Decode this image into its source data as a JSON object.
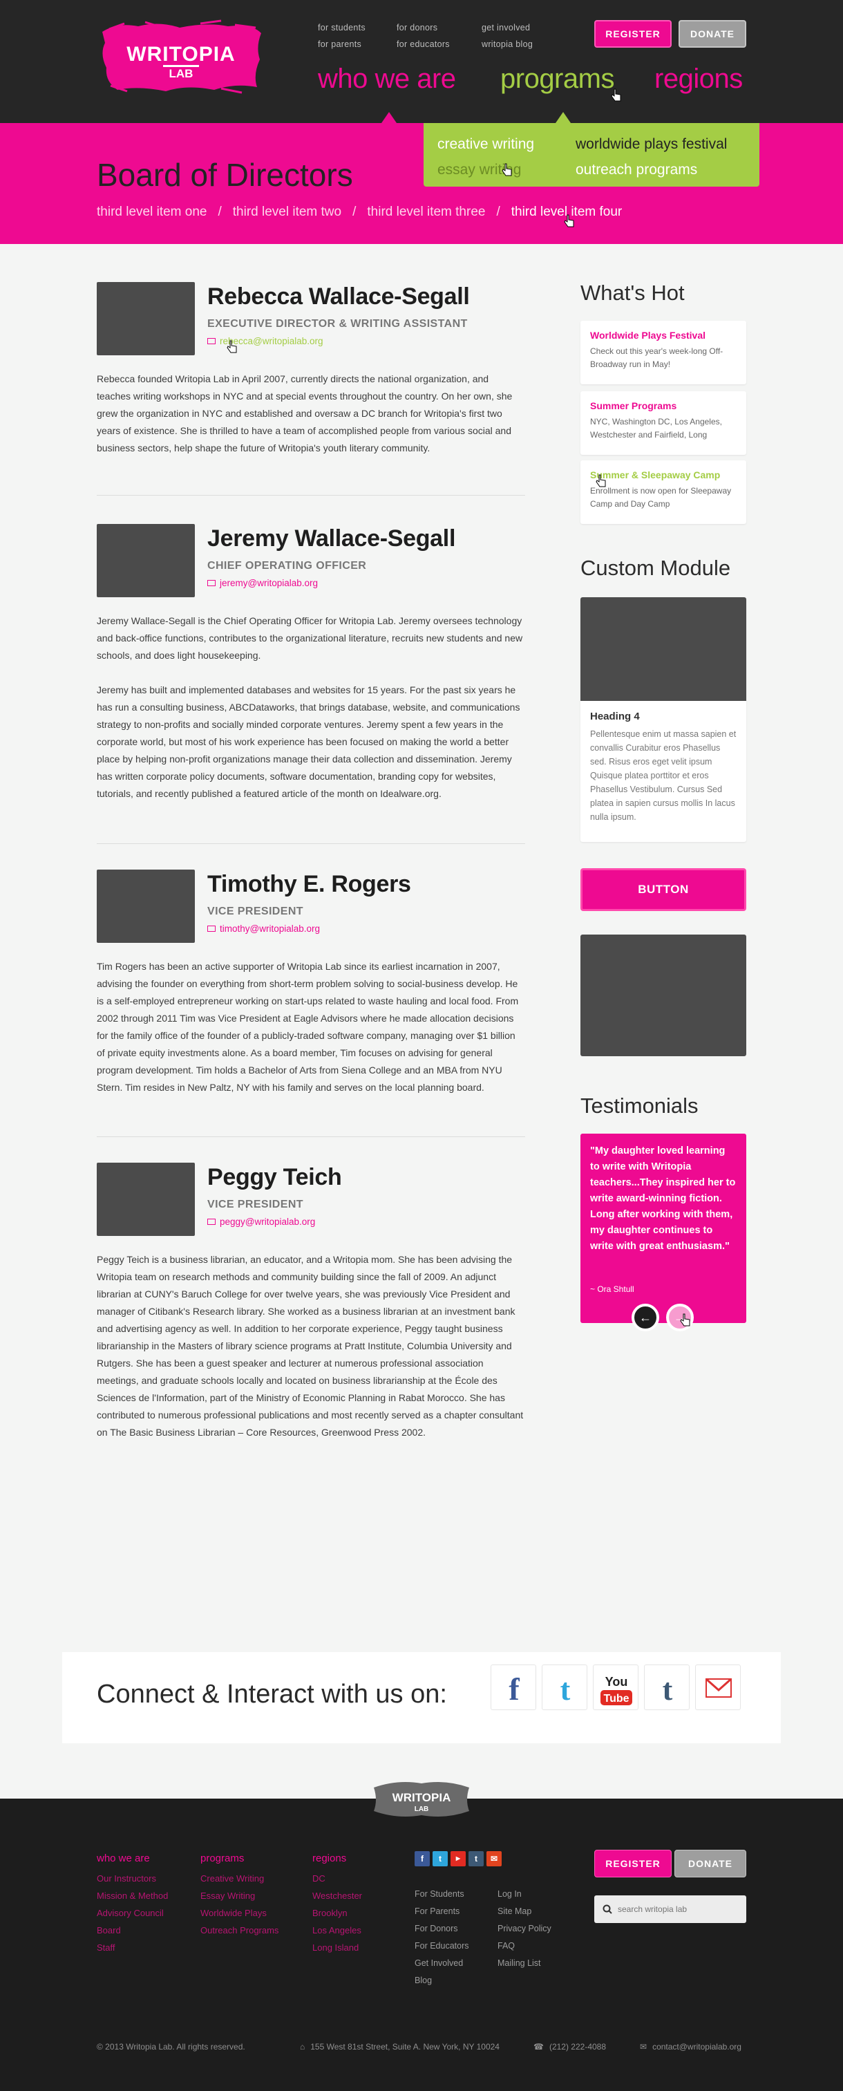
{
  "header": {
    "logo_text": "WRITOPIA LAB",
    "top_links_col1": [
      "for students",
      "for parents"
    ],
    "top_links_col2": [
      "for donors",
      "for educators"
    ],
    "top_links_col3": [
      "get involved",
      "writopia blog"
    ],
    "register": "REGISTER",
    "donate": "DONATE",
    "nav": [
      "who we are",
      "programs",
      "regions"
    ]
  },
  "dropdown": {
    "col1": [
      "creative writing",
      "essay writing"
    ],
    "col2": [
      "worldwide plays festival",
      "outreach programs"
    ]
  },
  "band": {
    "title": "Board of Directors",
    "crumbs": [
      "third level item one",
      "third level item two",
      "third level item three",
      "third level item four"
    ],
    "sep": "/"
  },
  "people": [
    {
      "name": "Rebecca Wallace-Segall",
      "role": "EXECUTIVE DIRECTOR & WRITING ASSISTANT",
      "email": "rebecca@writopialab.org",
      "bio": [
        "Rebecca founded Writopia Lab in April 2007, currently directs the national organization, and teaches writing workshops in NYC and at special events throughout the country. On her own, she grew the organization in NYC and established and oversaw a DC branch for Writopia's first two years of existence. She is thrilled to have a team of accomplished people from various social and business sectors, help shape the future of Writopia's youth literary community."
      ]
    },
    {
      "name": "Jeremy Wallace-Segall",
      "role": "CHIEF OPERATING OFFICER",
      "email": "jeremy@writopialab.org",
      "bio": [
        "Jeremy Wallace-Segall is the Chief Operating Officer for Writopia Lab. Jeremy oversees technology and back-office functions, contributes to the organizational literature, recruits new students and new schools, and does light housekeeping.",
        "Jeremy has built and implemented databases and websites for 15 years. For the past six years he has run a consulting business, ABCDataworks, that brings database, website, and communications strategy to non-profits and socially minded corporate ventures. Jeremy spent a few years in the corporate world, but most of his work experience has been focused on making the world a better place by helping non-profit organizations manage their data collection and dissemination. Jeremy has written corporate policy documents, software documentation, branding copy for websites, tutorials, and recently published a featured article of the month on Idealware.org."
      ]
    },
    {
      "name": "Timothy E. Rogers",
      "role": "VICE PRESIDENT",
      "email": "timothy@writopialab.org",
      "bio": [
        "Tim Rogers has been an active supporter of Writopia Lab since its earliest incarnation in 2007, advising the founder on everything from short-term problem solving to social-business develop. He is a self-employed entrepreneur working on start-ups related to waste hauling and local food. From 2002 through 2011 Tim was Vice President at Eagle Advisors where he made allocation decisions for the family office of the founder of a publicly-traded software company, managing over $1 billion of private equity investments alone. As a board member, Tim focuses on advising for general program development. Tim holds a Bachelor of Arts from Siena College and an MBA from NYU Stern. Tim resides in New Paltz, NY with his family and serves on the local planning board."
      ]
    },
    {
      "name": "Peggy Teich",
      "role": "VICE PRESIDENT",
      "email": "peggy@writopialab.org",
      "bio": [
        "Peggy Teich is a business librarian, an educator, and a Writopia mom. She has been advising the Writopia team on research methods and community building since the fall of 2009. An adjunct librarian at CUNY's Baruch College for over twelve years, she was previously Vice President and manager of Citibank's Research library. She worked as a business librarian at an investment bank and advertising agency as well. In addition to her corporate experience, Peggy taught business librarianship in the Masters of library science programs at Pratt Institute, Columbia University and Rutgers. She has been a guest speaker and lecturer at numerous professional association meetings, and graduate schools locally and located on business librarianship at the École des Sciences de l'Information, part of the Ministry of Economic Planning in Rabat Morocco. She has contributed to numerous professional publications and most recently served as a chapter consultant on The Basic Business Librarian – Core Resources, Greenwood Press 2002."
      ]
    }
  ],
  "sidebar": {
    "whats_hot_title": "What's Hot",
    "hot": [
      {
        "title": "Worldwide Plays Festival",
        "text": "Check out this year's week-long Off-Broadway run in May!",
        "color": "#ee0a91"
      },
      {
        "title": "Summer Programs",
        "text": "NYC, Washington DC, Los Angeles, Westchester and Fairfield, Long",
        "color": "#ee0a91"
      },
      {
        "title": "Summer & Sleepaway Camp",
        "text": "Enrollment is now open for Sleepaway Camp and Day Camp",
        "color": "#a4cd45"
      }
    ],
    "custom_title": "Custom Module",
    "module_heading": "Heading 4",
    "module_text": "Pellentesque enim ut massa sapien et convallis Curabitur eros Phasellus sed. Risus eros eget velit ipsum Quisque platea porttitor et eros Phasellus Vestibulum. Cursus Sed platea in sapien cursus mollis In lacus nulla ipsum.",
    "button": "BUTTON",
    "testimonials_title": "Testimonials",
    "quote": "\"My daughter loved learning to write with Writopia teachers...They inspired her to write award-winning fiction. Long after working with them, my daughter continues to write with great enthusiasm.\"",
    "quote_by": "~ Ora Shtull"
  },
  "connect": {
    "title": "Connect & Interact with us on:",
    "icons": [
      "facebook-icon",
      "twitter-icon",
      "youtube-icon",
      "tumblr-icon",
      "gmail-icon"
    ]
  },
  "footer": {
    "logo_text": "WRITOPIA LAB",
    "col1": {
      "head": "who we are",
      "items": [
        "Our Instructors",
        "Mission & Method",
        "Advisory Council",
        "Board",
        "Staff"
      ]
    },
    "col2": {
      "head": "programs",
      "items": [
        "Creative Writing",
        "Essay Writing",
        "Worldwide Plays",
        "Outreach Programs"
      ]
    },
    "col3": {
      "head": "regions",
      "items": [
        "DC",
        "Westchester",
        "Brooklyn",
        "Los Angeles",
        "Long Island"
      ]
    },
    "links1": [
      "For Students",
      "For Parents",
      "For Donors",
      "For Educators",
      "Get Involved",
      "Blog"
    ],
    "links2": [
      "Log In",
      "Site Map",
      "Privacy Policy",
      "FAQ",
      "Mailing List"
    ],
    "register": "REGISTER",
    "donate": "DONATE",
    "search_placeholder": "search writopia lab",
    "copyright": "© 2013 Writopia Lab. All rights reserved.",
    "address": "155 West 81st Street, Suite A. New York, NY 10024",
    "phone": "(212) 222-4088",
    "email": "contact@writopialab.org"
  }
}
